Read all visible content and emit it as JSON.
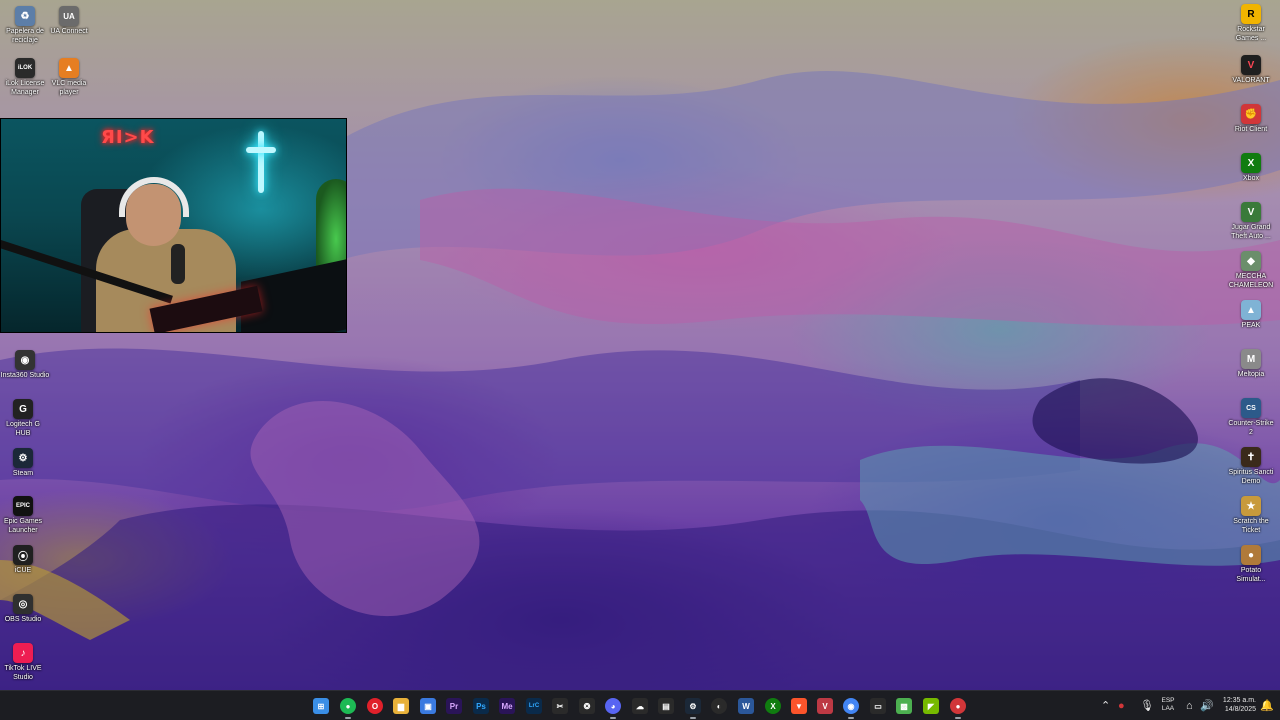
{
  "desktop": {
    "left_icons": [
      {
        "label": "Papelera de reciclaje",
        "icon": "recycle-bin-icon",
        "color": "#5c7ea8",
        "glyph": "♻"
      },
      {
        "label": "UA Connect",
        "icon": "ua-connect-icon",
        "color": "#6b6b6b",
        "glyph": "UA"
      },
      {
        "label": "iLok License Manager",
        "icon": "ilok-icon",
        "color": "#2a2a2a",
        "glyph": "iLOK"
      },
      {
        "label": "VLC media player",
        "icon": "vlc-icon",
        "color": "#e67e22",
        "glyph": "▲"
      },
      {
        "label": "Insta360 Studio",
        "icon": "insta360-icon",
        "color": "#333333",
        "glyph": "◉"
      },
      {
        "label": "Logitech G HUB",
        "icon": "logitech-icon",
        "color": "#222222",
        "glyph": "G"
      },
      {
        "label": "Steam",
        "icon": "steam-icon",
        "color": "#1b2838",
        "glyph": "⚙"
      },
      {
        "label": "Epic Games Launcher",
        "icon": "epic-games-icon",
        "color": "#111111",
        "glyph": "EPIC"
      },
      {
        "label": "iCUE",
        "icon": "icue-icon",
        "color": "#202020",
        "glyph": "⦿"
      },
      {
        "label": "OBS Studio",
        "icon": "obs-icon",
        "color": "#303030",
        "glyph": "◎"
      },
      {
        "label": "TikTok LIVE Studio",
        "icon": "tiktok-live-icon",
        "color": "#ee1d52",
        "glyph": "♪"
      }
    ],
    "right_icons": [
      {
        "label": "Rockstar Games ...",
        "icon": "rockstar-icon",
        "color": "#f1b400",
        "glyph": "R"
      },
      {
        "label": "VALORANT",
        "icon": "valorant-icon",
        "color": "#1f1f1f",
        "glyph": "V"
      },
      {
        "label": "Riot Client",
        "icon": "riot-client-icon",
        "color": "#d13639",
        "glyph": "✊"
      },
      {
        "label": "Xbox",
        "icon": "xbox-icon",
        "color": "#107c10",
        "glyph": "X"
      },
      {
        "label": "Jugar Grand Theft Auto ...",
        "icon": "gta-icon",
        "color": "#3a7a3a",
        "glyph": "V"
      },
      {
        "label": "MECCHA CHAMELEON",
        "icon": "meccha-chameleon-icon",
        "color": "#6b8e6b",
        "glyph": "◆"
      },
      {
        "label": "PEAK",
        "icon": "peak-icon",
        "color": "#7fb3d5",
        "glyph": "▲"
      },
      {
        "label": "Meltopia",
        "icon": "meltopia-icon",
        "color": "#8a8a8a",
        "glyph": "M"
      },
      {
        "label": "Counter-Strike 2",
        "icon": "counter-strike-icon",
        "color": "#2c5a8a",
        "glyph": "CS"
      },
      {
        "label": "Spiritus Sancti Demo",
        "icon": "spiritus-sancti-icon",
        "color": "#3a2a1a",
        "glyph": "✝"
      },
      {
        "label": "Scratch the Ticket",
        "icon": "scratch-ticket-icon",
        "color": "#c89a3c",
        "glyph": "★"
      },
      {
        "label": "Potato Simulat...",
        "icon": "potato-simulator-icon",
        "color": "#b07a3a",
        "glyph": "●"
      }
    ]
  },
  "webcam": {
    "neon_sign": "ЯI>K"
  },
  "taskbar": {
    "apps": [
      {
        "name": "start-button",
        "glyph": "⊞",
        "color": "#3a8ee6"
      },
      {
        "name": "spotify",
        "glyph": "●",
        "color": "#1db954"
      },
      {
        "name": "opera",
        "glyph": "O",
        "color": "#e0202a"
      },
      {
        "name": "file-explorer",
        "glyph": "▆",
        "color": "#e8b13a"
      },
      {
        "name": "photos",
        "glyph": "▣",
        "color": "#3a7ae0"
      },
      {
        "name": "premiere-pro",
        "glyph": "Pr",
        "color": "#2a1458"
      },
      {
        "name": "photoshop",
        "glyph": "Ps",
        "color": "#0a2a4a"
      },
      {
        "name": "media-encoder",
        "glyph": "Me",
        "color": "#2a1458"
      },
      {
        "name": "lightroom-classic",
        "glyph": "LrC",
        "color": "#0a2a4a"
      },
      {
        "name": "capcut",
        "glyph": "✂",
        "color": "#2a2a2a"
      },
      {
        "name": "chatgpt",
        "glyph": "❂",
        "color": "#2a2a2a"
      },
      {
        "name": "discord",
        "glyph": "◕",
        "color": "#5865f2"
      },
      {
        "name": "onedrive",
        "glyph": "☁",
        "color": "#2a2a2a"
      },
      {
        "name": "notepad",
        "glyph": "▤",
        "color": "#2a2a2a"
      },
      {
        "name": "steam",
        "glyph": "⚙",
        "color": "#1b2838"
      },
      {
        "name": "edge",
        "glyph": "◐",
        "color": "#2a2a2a"
      },
      {
        "name": "word",
        "glyph": "W",
        "color": "#2b579a"
      },
      {
        "name": "xbox",
        "glyph": "X",
        "color": "#107c10"
      },
      {
        "name": "brave",
        "glyph": "▼",
        "color": "#fb542b"
      },
      {
        "name": "valorant",
        "glyph": "V",
        "color": "#bd3944"
      },
      {
        "name": "chrome",
        "glyph": "◉",
        "color": "#4285f4"
      },
      {
        "name": "save-icon",
        "glyph": "▭",
        "color": "#2a2a2a"
      },
      {
        "name": "minecraft",
        "glyph": "▩",
        "color": "#4caf50"
      },
      {
        "name": "nvidia-app",
        "glyph": "◤",
        "color": "#76b900"
      },
      {
        "name": "recording-app",
        "glyph": "●",
        "color": "#d13639"
      }
    ],
    "language": "ESP",
    "region": "LAA",
    "time": "12:35 a.m.",
    "date": "14/8/2025"
  }
}
